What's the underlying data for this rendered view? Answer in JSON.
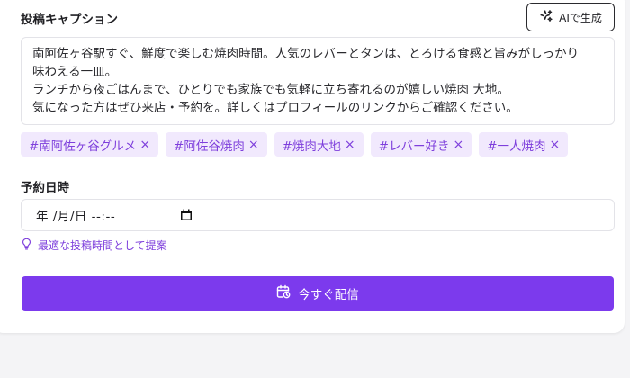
{
  "caption": {
    "label": "投稿キャプション",
    "ai_button_label": "AIで生成",
    "text": "南阿佐ヶ谷駅すぐ、鮮度で楽しむ焼肉時間。人気のレバーとタンは、とろける食感と旨みがしっかり\n味わえる一皿。\nランチから夜ごはんまで、ひとりでも家族でも気軽に立ち寄れるのが嬉しい焼肉 大地。\n気になった方はぜひ来店・予約を。詳しくはプロフィールのリンクからご確認ください。"
  },
  "tags": [
    {
      "label": "#南阿佐ヶ谷グルメ",
      "remove": "×"
    },
    {
      "label": "#阿佐谷焼肉",
      "remove": "×"
    },
    {
      "label": "#焼肉大地",
      "remove": "×"
    },
    {
      "label": "#レバー好き",
      "remove": "×"
    },
    {
      "label": "#一人焼肉",
      "remove": "×"
    }
  ],
  "schedule": {
    "label": "予約日時",
    "input_placeholder": "年 /月/日  --:--",
    "suggest_label": "最適な投稿時間として提案"
  },
  "publish": {
    "label": "今すぐ配信"
  },
  "colors": {
    "accent": "#7c3aed",
    "tag_bg": "#f1e9fd",
    "tag_text": "#7e3fdc"
  },
  "icons": {
    "ai": "sparkles-icon",
    "calendar": "calendar-icon",
    "suggest": "lightbulb-icon",
    "publish": "calendar-clock-icon"
  }
}
